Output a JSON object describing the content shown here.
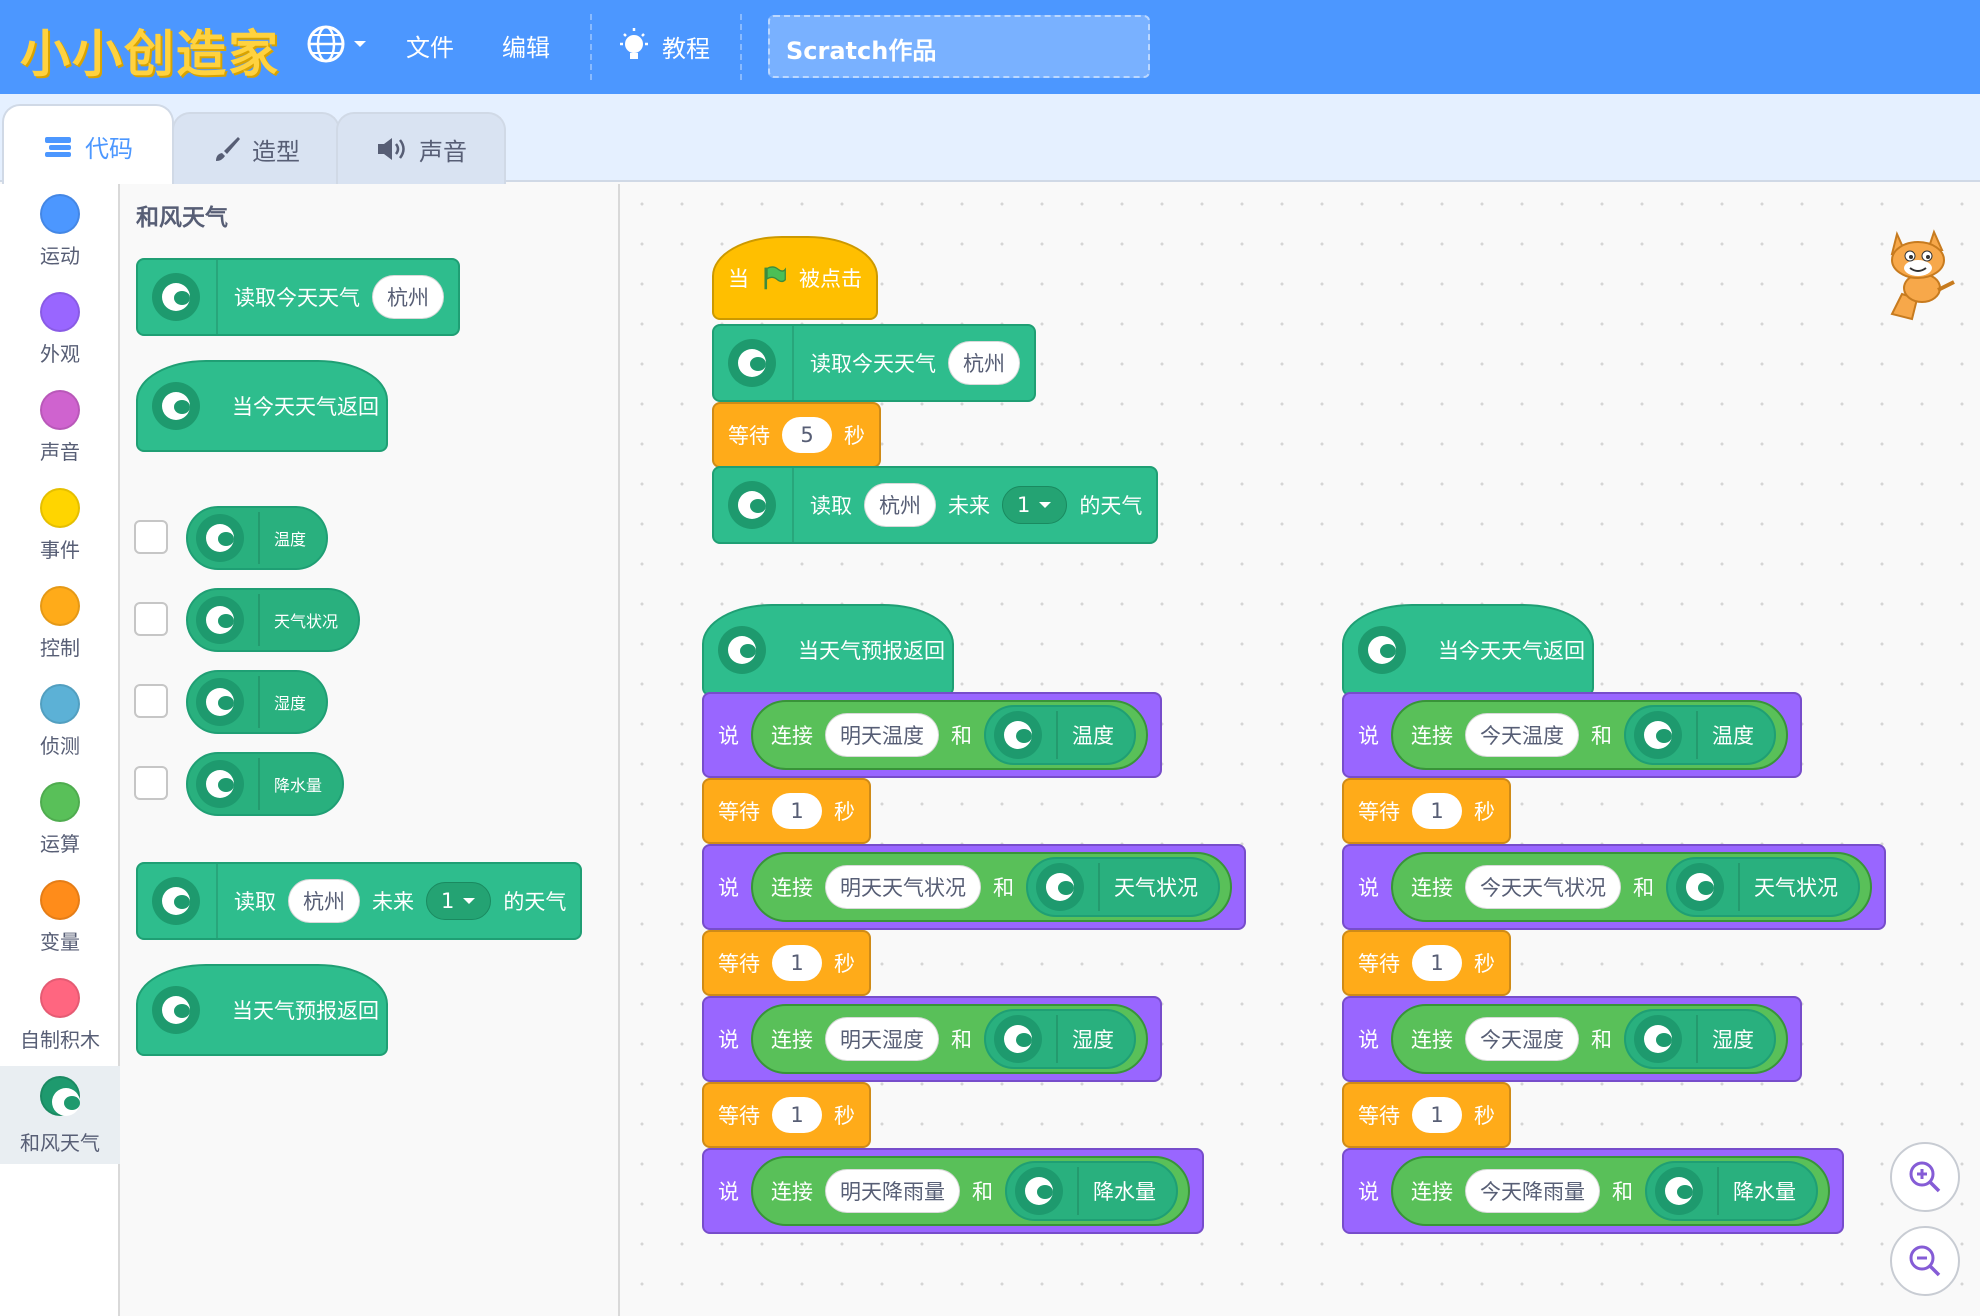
{
  "topbar": {
    "logo": "小小创造家",
    "file": "文件",
    "edit": "编辑",
    "tutorials": "教程",
    "project_title": "Scratch作品"
  },
  "tabs": {
    "code": "代码",
    "costumes": "造型",
    "sounds": "声音"
  },
  "categories": [
    {
      "label": "运动",
      "color": "#4c97ff"
    },
    {
      "label": "外观",
      "color": "#9966ff"
    },
    {
      "label": "声音",
      "color": "#cf63cf"
    },
    {
      "label": "事件",
      "color": "#ffd500"
    },
    {
      "label": "控制",
      "color": "#ffab19"
    },
    {
      "label": "侦测",
      "color": "#5cb1d6"
    },
    {
      "label": "运算",
      "color": "#59c059"
    },
    {
      "label": "变量",
      "color": "#ff8c1a"
    },
    {
      "label": "自制积木",
      "color": "#ff6680"
    },
    {
      "label": "和风天气",
      "color": "#2ebd8d"
    }
  ],
  "palette": {
    "heading": "和风天气",
    "read_today": "读取今天天气",
    "city": "杭州",
    "when_today": "当今天天气返回",
    "temp": "温度",
    "condition": "天气状况",
    "humidity": "湿度",
    "precip": "降水量",
    "read": "读取",
    "future": "未来",
    "days": "1",
    "of_weather": "的天气",
    "when_forecast": "当天气预报返回"
  },
  "script1": {
    "when": "当",
    "clicked": "被点击",
    "read_today": "读取今天天气",
    "city": "杭州",
    "wait": "等待",
    "wait_val": "5",
    "sec": "秒",
    "read": "读取",
    "future": "未来",
    "days": "1",
    "of_weather": "的天气"
  },
  "script2": {
    "hat": "当天气预报返回",
    "say": "说",
    "join": "连接",
    "and": "和",
    "wait": "等待",
    "wait_val": "1",
    "sec": "秒",
    "rows": [
      {
        "text": "明天温度",
        "rep": "温度"
      },
      {
        "text": "明天天气状况",
        "rep": "天气状况"
      },
      {
        "text": "明天湿度",
        "rep": "湿度"
      },
      {
        "text": "明天降雨量",
        "rep": "降水量"
      }
    ]
  },
  "script3": {
    "hat": "当今天天气返回",
    "say": "说",
    "join": "连接",
    "and": "和",
    "wait": "等待",
    "wait_val": "1",
    "sec": "秒",
    "rows": [
      {
        "text": "今天温度",
        "rep": "温度"
      },
      {
        "text": "今天天气状况",
        "rep": "天气状况"
      },
      {
        "text": "今天湿度",
        "rep": "湿度"
      },
      {
        "text": "今天降雨量",
        "rep": "降水量"
      }
    ]
  }
}
